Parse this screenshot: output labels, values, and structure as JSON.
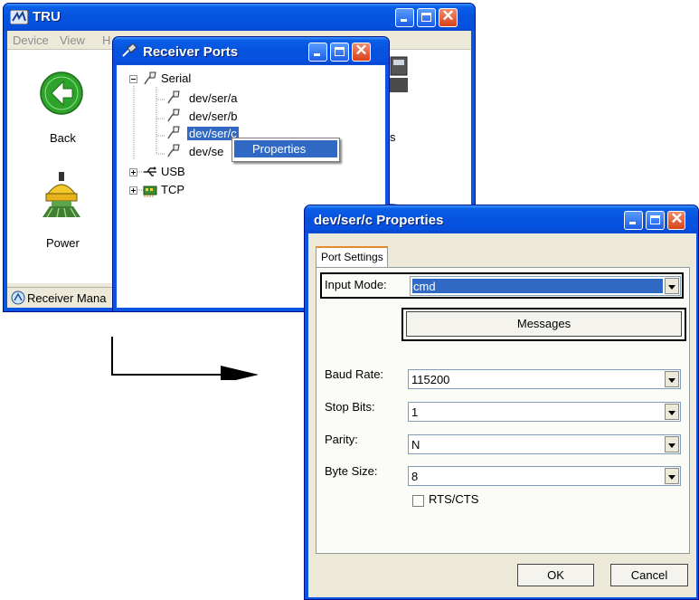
{
  "tru_window": {
    "title": "TRU",
    "menu": [
      "Device",
      "View",
      "H"
    ],
    "back_label": "Back",
    "power_label": "Power",
    "status_label": "Receiver Mana",
    "partial_label": "s"
  },
  "receiver_ports_window": {
    "title": "Receiver Ports",
    "tree": {
      "serial_label": "Serial",
      "serial_children": [
        "dev/ser/a",
        "dev/ser/b",
        "dev/ser/c",
        "dev/se"
      ],
      "usb_label": "USB",
      "tcp_label": "TCP"
    },
    "context_menu": [
      "Properties"
    ]
  },
  "properties_dialog": {
    "title": "dev/ser/c Properties",
    "tab_label": "Port Settings",
    "input_mode_label": "Input Mode:",
    "input_mode_value": "cmd",
    "messages_button": "Messages",
    "baud_rate_label": "Baud Rate:",
    "baud_rate_value": "115200",
    "stop_bits_label": "Stop Bits:",
    "stop_bits_value": "1",
    "parity_label": "Parity:",
    "parity_value": "N",
    "byte_size_label": "Byte Size:",
    "byte_size_value": "8",
    "rts_cts_label": "RTS/CTS",
    "rts_cts_checked": false,
    "ok_button": "OK",
    "cancel_button": "Cancel"
  },
  "colors": {
    "xp_title_blue": "#0553dc",
    "selection_blue": "#316ac5",
    "dialog_gray": "#ece9d8"
  }
}
